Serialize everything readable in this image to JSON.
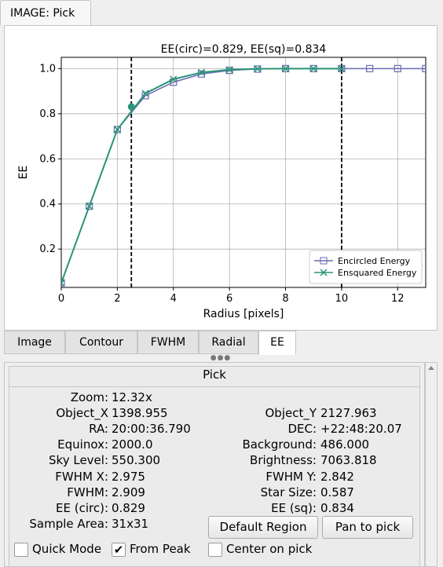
{
  "window": {
    "title": "IMAGE: Pick"
  },
  "chart_data": {
    "type": "line",
    "title": "EE(circ)=0.829, EE(sq)=0.834",
    "xlabel": "Radius [pixels]",
    "ylabel": "EE",
    "xlim": [
      0,
      13
    ],
    "ylim": [
      0.03,
      1.05
    ],
    "xticks": [
      0,
      2,
      4,
      6,
      8,
      10,
      12
    ],
    "yticks": [
      0.2,
      0.4,
      0.6,
      0.8,
      1.0
    ],
    "grid": true,
    "legend_position": "bottom-right",
    "vlines": [
      2.5,
      10
    ],
    "marker_point": {
      "x": 2.5,
      "y": 0.831
    },
    "series": [
      {
        "name": "Encircled Energy",
        "color": "#6a6ab4",
        "marker": "square",
        "x": [
          0,
          1,
          2,
          3,
          4,
          5,
          6,
          7,
          8,
          9,
          10,
          11,
          12,
          13
        ],
        "y": [
          0.05,
          0.39,
          0.73,
          0.88,
          0.94,
          0.976,
          0.992,
          0.998,
          1.0,
          1.0,
          1.0,
          1.0,
          1.0,
          1.0
        ]
      },
      {
        "name": "Ensquared Energy",
        "color": "#2a9576",
        "marker": "x",
        "x": [
          0,
          1,
          2,
          3,
          4,
          5,
          6,
          7,
          8,
          9,
          10
        ],
        "y": [
          0.05,
          0.39,
          0.73,
          0.89,
          0.953,
          0.983,
          0.995,
          0.999,
          1.0,
          1.0,
          1.0
        ]
      }
    ]
  },
  "tabs": [
    "Image",
    "Contour",
    "FWHM",
    "Radial",
    "EE"
  ],
  "active_tab": "EE",
  "pick": {
    "title": "Pick",
    "left": [
      {
        "label": "Zoom:",
        "value": "12.32x"
      },
      {
        "label": "Object_X",
        "value": "1398.955"
      },
      {
        "label": "RA:",
        "value": "20:00:36.790"
      },
      {
        "label": "Equinox:",
        "value": "2000.0"
      },
      {
        "label": "Sky Level:",
        "value": "550.300"
      },
      {
        "label": "FWHM X:",
        "value": "2.975"
      },
      {
        "label": "FWHM:",
        "value": "2.909"
      },
      {
        "label": "EE (circ):",
        "value": "0.829"
      },
      {
        "label": "Sample Area:",
        "value": "31x31"
      }
    ],
    "right": [
      {
        "label": "Object_Y",
        "value": "2127.963"
      },
      {
        "label": "DEC:",
        "value": "+22:48:20.07"
      },
      {
        "label": "Background:",
        "value": "486.000"
      },
      {
        "label": "Brightness:",
        "value": "7063.818"
      },
      {
        "label": "FWHM Y:",
        "value": "2.842"
      },
      {
        "label": "Star Size:",
        "value": "0.587"
      },
      {
        "label": "EE (sq):",
        "value": "0.834"
      }
    ],
    "default_region_button": "Default Region",
    "pan_to_pick_button": "Pan to pick",
    "quick_mode": {
      "label": "Quick Mode",
      "checked": false
    },
    "from_peak": {
      "label": "From Peak",
      "checked": true
    },
    "center_on_pick": {
      "label": "Center on pick",
      "checked": false
    }
  }
}
